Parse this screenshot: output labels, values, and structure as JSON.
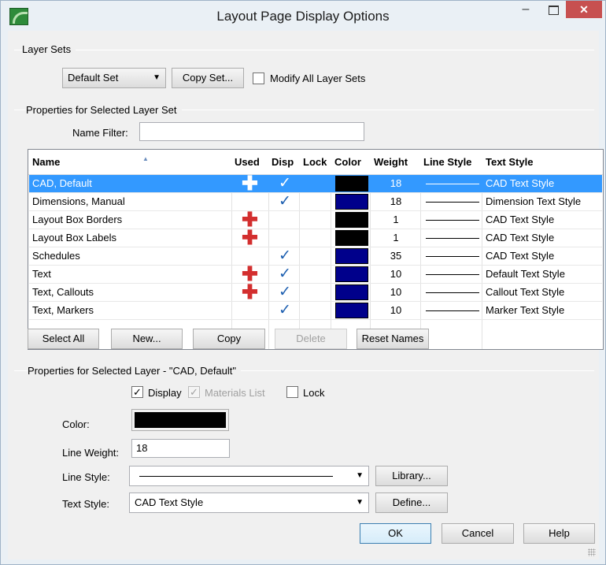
{
  "window": {
    "title": "Layout Page Display Options",
    "min_glyph": "–",
    "close_glyph": "✕"
  },
  "layer_sets": {
    "group_label": "Layer Sets",
    "selected_set": "Default Set",
    "copy_set_label": "Copy Set...",
    "modify_all_label": "Modify All Layer Sets",
    "modify_all_checked": false
  },
  "properties_set": {
    "group_label": "Properties for Selected Layer Set",
    "name_filter_label": "Name Filter:",
    "name_filter_value": ""
  },
  "table": {
    "columns": [
      "Name",
      "Used",
      "Disp",
      "Lock",
      "Color",
      "Weight",
      "Line Style",
      "Text Style"
    ],
    "rows": [
      {
        "name": "CAD,  Default",
        "used": true,
        "disp": true,
        "lock": false,
        "color": "#000000",
        "weight": "18",
        "text_style": "CAD Text Style",
        "selected": true
      },
      {
        "name": "Dimensions,  Manual",
        "used": false,
        "disp": true,
        "lock": false,
        "color": "#00008b",
        "weight": "18",
        "text_style": "Dimension Text Style",
        "selected": false
      },
      {
        "name": "Layout Box Borders",
        "used": true,
        "disp": false,
        "lock": false,
        "color": "#000000",
        "weight": "1",
        "text_style": "CAD Text Style",
        "selected": false
      },
      {
        "name": "Layout Box Labels",
        "used": true,
        "disp": false,
        "lock": false,
        "color": "#000000",
        "weight": "1",
        "text_style": "CAD Text Style",
        "selected": false
      },
      {
        "name": "Schedules",
        "used": false,
        "disp": true,
        "lock": false,
        "color": "#00008b",
        "weight": "35",
        "text_style": "CAD Text Style",
        "selected": false
      },
      {
        "name": "Text",
        "used": true,
        "disp": true,
        "lock": false,
        "color": "#00008b",
        "weight": "10",
        "text_style": "Default Text Style",
        "selected": false
      },
      {
        "name": "Text,  Callouts",
        "used": true,
        "disp": true,
        "lock": false,
        "color": "#00008b",
        "weight": "10",
        "text_style": "Callout Text Style",
        "selected": false
      },
      {
        "name": "Text,  Markers",
        "used": false,
        "disp": true,
        "lock": false,
        "color": "#00008b",
        "weight": "10",
        "text_style": "Marker Text Style",
        "selected": false
      }
    ],
    "plus_glyph": "✚",
    "check_glyph": "✓",
    "sort_glyph": "▲"
  },
  "table_buttons": {
    "select_all": "Select All",
    "new": "New...",
    "copy": "Copy",
    "delete": "Delete",
    "reset_names": "Reset Names"
  },
  "properties_layer": {
    "group_label": "Properties for Selected Layer - \"CAD,  Default\"",
    "display_label": "Display",
    "display_checked": true,
    "materials_label": "Materials List",
    "materials_checked": true,
    "lock_label": "Lock",
    "lock_checked": false,
    "color_label": "Color:",
    "color_value": "#000000",
    "line_weight_label": "Line Weight:",
    "line_weight_value": "18",
    "line_style_label": "Line Style:",
    "library_label": "Library...",
    "text_style_label": "Text Style:",
    "text_style_value": "CAD Text Style",
    "define_label": "Define..."
  },
  "footer": {
    "ok": "OK",
    "cancel": "Cancel",
    "help": "Help"
  },
  "check_glyph": "✓",
  "dropdown_glyph": "▼"
}
